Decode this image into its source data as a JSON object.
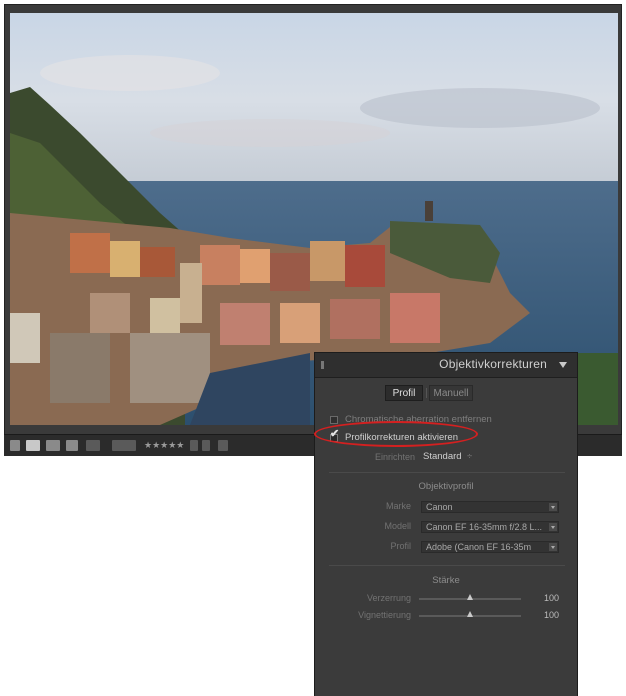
{
  "filmstrip": {
    "icons": [
      "grid-view-icon",
      "loupe-view-icon",
      "compare-view-icon",
      "survey-view-icon",
      "flag-icon",
      "flag-reject-icon"
    ],
    "stars": "★★★★★"
  },
  "panel": {
    "title": "Objektivkorrekturen",
    "tabs": {
      "profil": "Profil",
      "manuell": "Manuell"
    },
    "chromatic": "Chromatische aberration entfernen",
    "enable_profile": "Profilkorrekturen aktivieren",
    "setup_label": "Einrichten",
    "setup_value": "Standard",
    "setup_arrow": "÷",
    "section_profile": "Objektivprofil",
    "marke_label": "Marke",
    "marke_value": "Canon",
    "modell_label": "Modell",
    "modell_value": "Canon EF 16-35mm f/2.8 L...",
    "profil_label": "Profil",
    "profil_value": "Adobe (Canon EF 16-35m",
    "section_strength": "Stärke",
    "verzerrung_label": "Verzerrung",
    "verzerrung_value": "100",
    "verzerrung_level": 0.5,
    "vignettierung_label": "Vignettierung",
    "vignettierung_value": "100",
    "vignettierung_level": 0.5
  },
  "colors": {
    "highlight_ellipse": "#d42020",
    "panel_bg": "#3b3b3b",
    "frame_bg": "#3a3a3a"
  }
}
